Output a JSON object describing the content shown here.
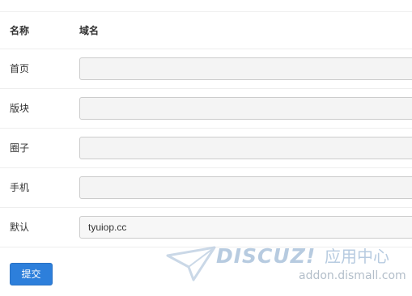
{
  "table": {
    "header": {
      "name": "名称",
      "domain": "域名"
    },
    "rows": [
      {
        "label": "首页",
        "value": "",
        "placeholder": ""
      },
      {
        "label": "版块",
        "value": "",
        "placeholder": ""
      },
      {
        "label": "圈子",
        "value": "",
        "placeholder": ""
      },
      {
        "label": "手机",
        "value": "",
        "placeholder": ""
      },
      {
        "label": "默认",
        "value": "tyuiop.cc",
        "placeholder": ""
      }
    ]
  },
  "actions": {
    "submit_label": "提交"
  },
  "watermark": {
    "brand": "DISCUZ!",
    "brand_cn": "应用中心",
    "url": "addon.dismall.com"
  },
  "colors": {
    "accent": "#2d7fdb",
    "watermark": "#9fbad6"
  },
  "icons": {
    "watermark_logo": "discuz-arrow-logo"
  }
}
